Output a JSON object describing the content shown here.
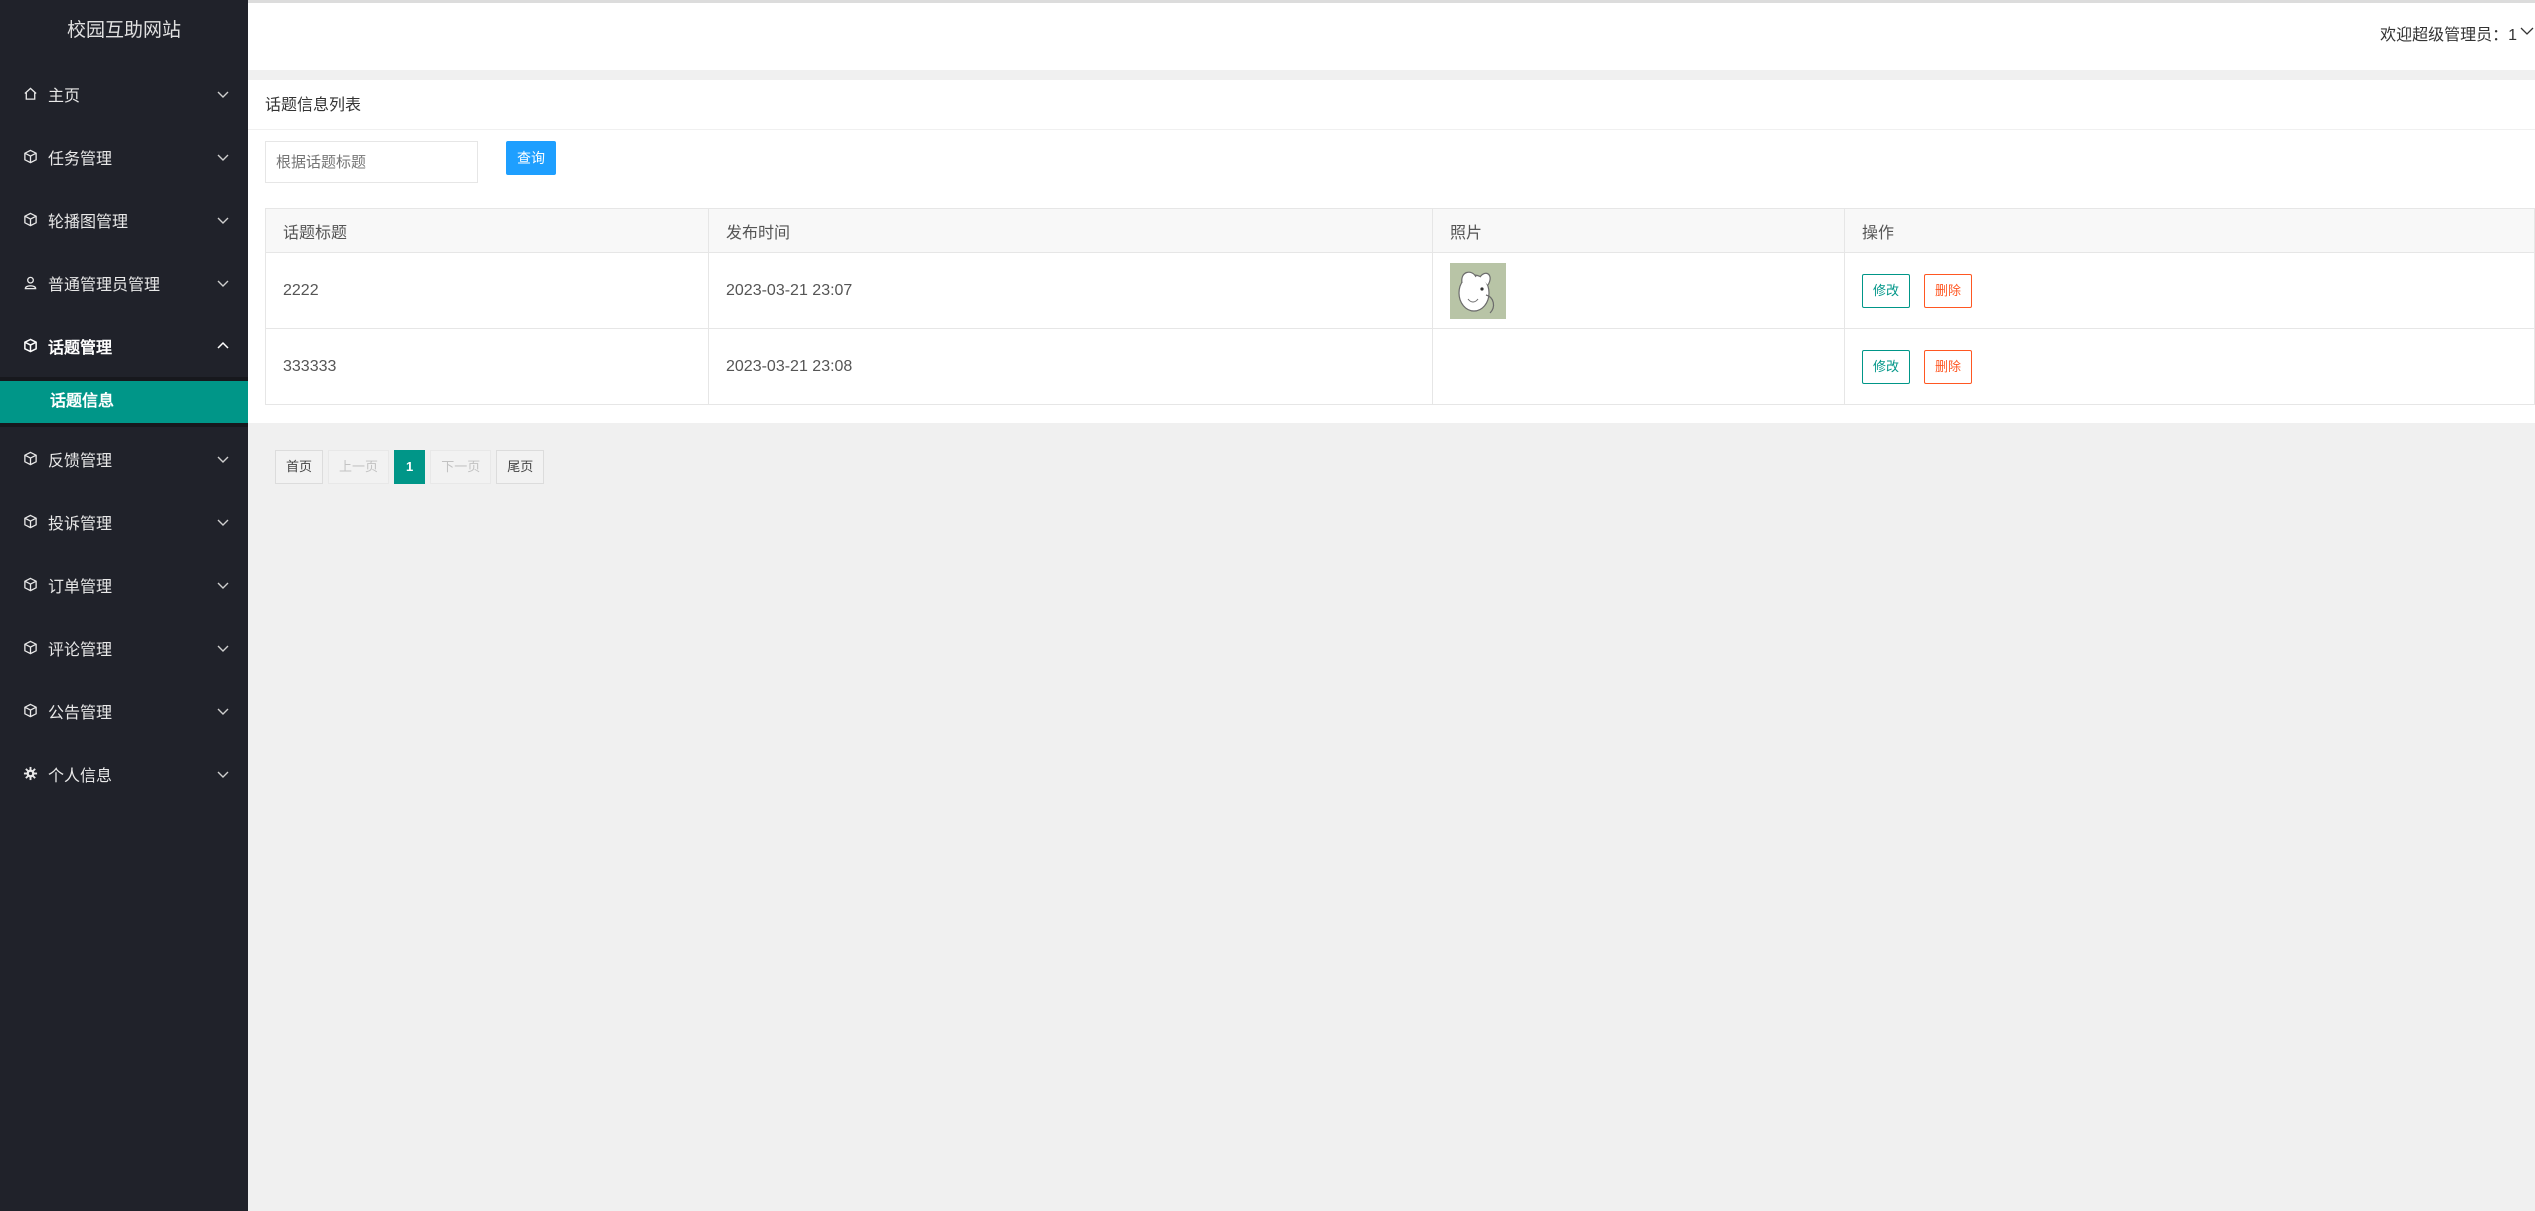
{
  "app": {
    "brand": "校园互助网站"
  },
  "header": {
    "welcome": "欢迎超级管理员：1"
  },
  "sidebar": {
    "items": [
      {
        "label": "主页",
        "icon": "home-icon"
      },
      {
        "label": "任务管理",
        "icon": "cube-icon"
      },
      {
        "label": "轮播图管理",
        "icon": "cube-icon"
      },
      {
        "label": "普通管理员管理",
        "icon": "user-icon"
      },
      {
        "label": "话题管理",
        "icon": "cube-icon",
        "expanded": true
      },
      {
        "label": "反馈管理",
        "icon": "cube-icon"
      },
      {
        "label": "投诉管理",
        "icon": "cube-icon"
      },
      {
        "label": "订单管理",
        "icon": "cube-icon"
      },
      {
        "label": "评论管理",
        "icon": "cube-icon"
      },
      {
        "label": "公告管理",
        "icon": "cube-icon"
      },
      {
        "label": "个人信息",
        "icon": "gear-icon"
      }
    ],
    "submenu": {
      "active_label": "话题信息"
    }
  },
  "panel": {
    "title": "话题信息列表",
    "search": {
      "placeholder": "根据话题标题",
      "value": "",
      "button": "查询"
    },
    "table": {
      "columns": [
        "话题标题",
        "发布时间",
        "照片",
        "操作"
      ],
      "rows": [
        {
          "title": "2222",
          "time": "2023-03-21 23:07",
          "has_photo": true
        },
        {
          "title": "333333",
          "time": "2023-03-21 23:08",
          "has_photo": false
        }
      ],
      "edit_label": "修改",
      "delete_label": "删除"
    },
    "pager": {
      "first": "首页",
      "prev": "上一页",
      "current": "1",
      "next": "下一页",
      "last": "尾页"
    }
  },
  "colors": {
    "sidebar_bg": "#20222a",
    "accent": "#009688",
    "primary_button": "#1e9fff",
    "danger": "#ff5722"
  }
}
